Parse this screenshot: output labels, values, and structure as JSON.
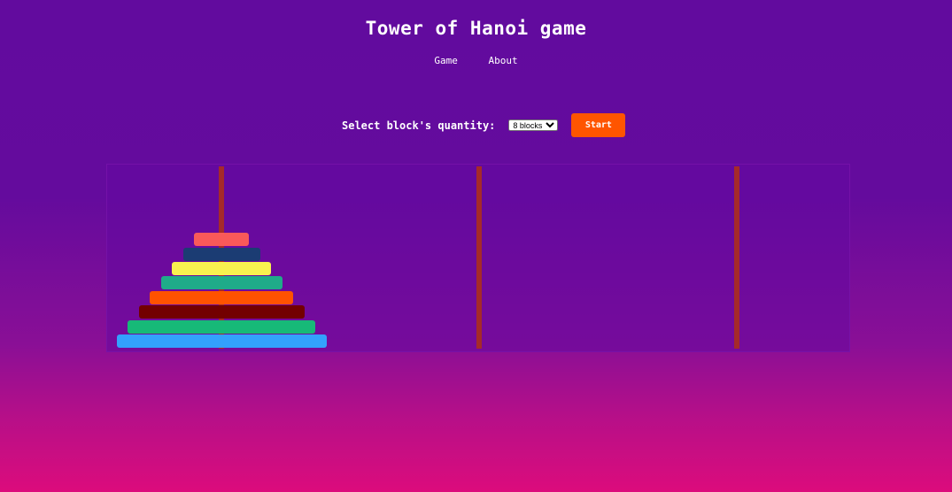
{
  "title": "Tower of Hanoi game",
  "nav": [
    {
      "label": "Game"
    },
    {
      "label": "About"
    }
  ],
  "controls": {
    "label": "Select block's quantity:",
    "selected": "8 blocks",
    "start_label": "Start",
    "start_color": "#ff5500"
  },
  "game": {
    "pole_color": "#a52a2a",
    "pegs": [
      {
        "discs": [
          {
            "size": 8,
            "color": "#33a1fd"
          },
          {
            "size": 7,
            "color": "#17b978"
          },
          {
            "size": 6,
            "color": "#730000"
          },
          {
            "size": 5,
            "color": "#ff5200"
          },
          {
            "size": 4,
            "color": "#1fab89"
          },
          {
            "size": 3,
            "color": "#f8f24f"
          },
          {
            "size": 2,
            "color": "#1b3c73"
          },
          {
            "size": 1,
            "color": "#f95959"
          }
        ]
      },
      {
        "discs": []
      },
      {
        "discs": []
      }
    ]
  }
}
